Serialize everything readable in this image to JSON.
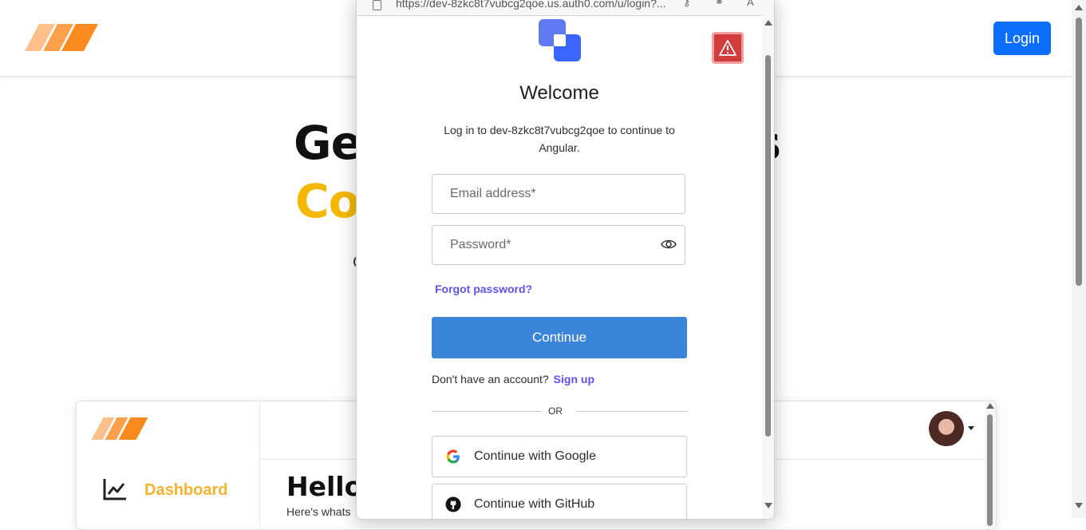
{
  "background": {
    "header": {
      "login_label": "Login"
    },
    "hero": {
      "line1_left": "Ge",
      "line1_right": "s",
      "line2_left": "Co",
      "line2_right": "",
      "sub_visible": "C"
    },
    "dashboard_preview": {
      "nav_item_label": "Dashboard",
      "greeting": "Hello,",
      "subtext": "Here's whats"
    }
  },
  "popup": {
    "address_bar": {
      "url": "https://dev-8zkc8t7vubcg2qoe.us.auth0.com/u/login?..."
    },
    "welcome": "Welcome",
    "description": "Log in to dev-8zkc8t7vubcg2qoe to continue to Angular.",
    "email_placeholder": "Email address*",
    "password_placeholder": "Password*",
    "forgot_password": "Forgot password?",
    "continue_label": "Continue",
    "no_account_text": "Don't have an account?",
    "signup_label": "Sign up",
    "or_label": "OR",
    "google_label": "Continue with Google",
    "github_label": "Continue with GitHub"
  },
  "colors": {
    "primary_button": "#0d6efd",
    "continue_button": "#3a84da",
    "link": "#5c53f0",
    "accent_yellow": "#f5b800",
    "warning_red": "#d33c3c"
  },
  "icons": [
    "brand-logo-icon",
    "warning-icon",
    "eye-icon",
    "google-icon",
    "github-icon",
    "chart-line-icon",
    "lock-icon"
  ]
}
